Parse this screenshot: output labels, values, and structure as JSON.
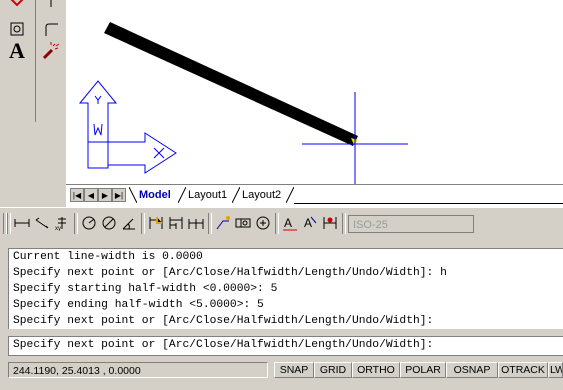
{
  "palette": {
    "tools_left": [
      "move-icon",
      "region-icon",
      "text-icon"
    ],
    "tools_right": [
      "polyline-icon",
      "fillet-icon",
      "explode-icon"
    ],
    "text_tool_glyph": "A"
  },
  "drawing": {
    "ucs_icon": {
      "y_label": "Y",
      "x_label": "X",
      "w_label": "W"
    },
    "crosshair_color": "#0000ff",
    "polyline_color": "#000000",
    "grip_color": "#e8e000"
  },
  "tabs": {
    "nav": [
      "first-tab-icon",
      "prev-tab-icon",
      "next-tab-icon",
      "last-tab-icon"
    ],
    "items": [
      {
        "label": "Model",
        "active": true
      },
      {
        "label": "Layout1",
        "active": false
      },
      {
        "label": "Layout2",
        "active": false
      }
    ]
  },
  "toolbar": {
    "icons": [
      "linear-dimension-icon",
      "aligned-dimension-icon",
      "ordinate-dimension-icon",
      "radius-dimension-icon",
      "diameter-dimension-icon",
      "angular-dimension-icon",
      "quick-dimension-icon",
      "baseline-dimension-icon",
      "continue-dimension-icon",
      "leader-icon",
      "tolerance-icon",
      "center-mark-icon",
      "dimension-edit-icon",
      "dimension-text-edit-icon",
      "dimension-update-icon"
    ],
    "dimstyle_value": "ISO-25"
  },
  "command": {
    "history": [
      "Current line-width is 0.0000",
      "Specify next point or [Arc/Close/Halfwidth/Length/Undo/Width]: h",
      "Specify starting half-width <0.0000>: 5",
      "Specify ending half-width <5.0000>: 5",
      "Specify next point or [Arc/Close/Halfwidth/Length/Undo/Width]:"
    ],
    "prompt": "Specify next point or [Arc/Close/Halfwidth/Length/Undo/Width]:"
  },
  "status": {
    "coordinates": "244.1190, 25.4013 , 0.0000",
    "toggles": [
      "SNAP",
      "GRID",
      "ORTHO",
      "POLAR",
      "OSNAP",
      "OTRACK",
      "LW"
    ]
  }
}
